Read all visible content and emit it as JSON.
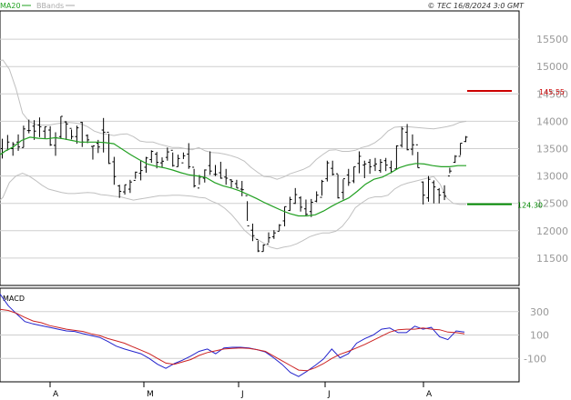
{
  "chart_data": [
    {
      "type": "line",
      "panel": "price",
      "credit": "© TEC 16/8/2024 3:0 GMT",
      "legend": [
        {
          "name": "MA20",
          "color": "#22a022"
        },
        {
          "name": "BBands",
          "color": "#aaaaaa"
        }
      ],
      "x_ticks": [
        "A",
        "M",
        "J",
        "J",
        "A"
      ],
      "ylim": [
        11000,
        16000
      ],
      "y_ticks": [
        11500,
        12000,
        12500,
        13000,
        13500,
        14000,
        14500,
        15000,
        15500
      ],
      "y_tick_labels": [
        "11500",
        "12000",
        "12500",
        "13000",
        "13500",
        "14000",
        "14500",
        "15000",
        "15500"
      ],
      "grid": true,
      "ohlc": [
        [
          13500,
          13680,
          13320,
          13430
        ],
        [
          13470,
          13750,
          13470,
          13620
        ],
        [
          13500,
          13620,
          13370,
          13580
        ],
        [
          13620,
          13760,
          13460,
          13530
        ],
        [
          13520,
          13920,
          13520,
          13860
        ],
        [
          13830,
          14030,
          13780,
          13830
        ],
        [
          13910,
          14020,
          13660,
          13820
        ],
        [
          13930,
          14070,
          13710,
          13900
        ],
        [
          13820,
          13900,
          13690,
          13900
        ],
        [
          13840,
          13910,
          13550,
          13570
        ],
        [
          13560,
          13800,
          13370,
          13700
        ],
        [
          13720,
          14090,
          13680,
          14090
        ],
        [
          13990,
          14000,
          13660,
          13950
        ],
        [
          13870,
          13850,
          13670,
          13720
        ],
        [
          13720,
          13920,
          13590,
          13880
        ],
        [
          13980,
          13990,
          13530,
          13620
        ],
        [
          13740,
          13760,
          13600,
          13660
        ],
        [
          13540,
          13550,
          13300,
          13550
        ],
        [
          13600,
          13660,
          13420,
          13530
        ],
        [
          13840,
          14060,
          13430,
          13800
        ],
        [
          13800,
          13770,
          13220,
          13230
        ],
        [
          13260,
          13350,
          12840,
          12990
        ],
        [
          12820,
          12840,
          12600,
          12720
        ],
        [
          12710,
          12840,
          12660,
          12840
        ],
        [
          12760,
          12930,
          12690,
          12890
        ],
        [
          12920,
          13080,
          12950,
          13070
        ],
        [
          13050,
          13280,
          12920,
          13100
        ],
        [
          13160,
          13350,
          13060,
          13330
        ],
        [
          13300,
          13470,
          13240,
          13450
        ],
        [
          13400,
          13440,
          13140,
          13250
        ],
        [
          13240,
          13340,
          13160,
          13270
        ],
        [
          13340,
          13520,
          13280,
          13440
        ],
        [
          13470,
          13430,
          13170,
          13190
        ],
        [
          13170,
          13390,
          13170,
          13320
        ],
        [
          13240,
          13430,
          13310,
          13370
        ],
        [
          13400,
          13600,
          13130,
          13170
        ],
        [
          13160,
          13130,
          12790,
          12820
        ],
        [
          12780,
          13020,
          12840,
          12980
        ],
        [
          12960,
          13120,
          12880,
          13110
        ],
        [
          13190,
          13450,
          13020,
          13090
        ],
        [
          13030,
          13200,
          13000,
          13030
        ],
        [
          13060,
          13260,
          12950,
          12960
        ],
        [
          12980,
          13130,
          12840,
          12960
        ],
        [
          12930,
          12940,
          12790,
          12900
        ],
        [
          12860,
          12930,
          12780,
          12780
        ],
        [
          12760,
          12910,
          12630,
          12750
        ],
        [
          12640,
          12540,
          12180,
          12090
        ],
        [
          12010,
          12130,
          11810,
          11910
        ],
        [
          11840,
          11820,
          11610,
          11630
        ],
        [
          11620,
          11750,
          11620,
          11740
        ],
        [
          11760,
          11970,
          11780,
          11870
        ],
        [
          11890,
          12010,
          11850,
          11960
        ],
        [
          11990,
          12120,
          12000,
          12100
        ],
        [
          12180,
          12440,
          12080,
          12440
        ],
        [
          12370,
          12620,
          12360,
          12570
        ],
        [
          12500,
          12780,
          12490,
          12660
        ],
        [
          12600,
          12630,
          12350,
          12430
        ],
        [
          12400,
          12570,
          12270,
          12300
        ],
        [
          12350,
          12580,
          12250,
          12520
        ],
        [
          12540,
          12720,
          12520,
          12650
        ],
        [
          12610,
          12930,
          12640,
          12900
        ],
        [
          12950,
          13280,
          12900,
          13240
        ],
        [
          13140,
          13280,
          13010,
          13030
        ],
        [
          13040,
          13030,
          12590,
          12600
        ],
        [
          12700,
          12940,
          12570,
          12950
        ],
        [
          13020,
          13130,
          12820,
          12880
        ],
        [
          12910,
          13170,
          12870,
          13170
        ],
        [
          13230,
          13450,
          13050,
          13360
        ],
        [
          13200,
          13280,
          12960,
          13220
        ],
        [
          13250,
          13310,
          13040,
          13170
        ],
        [
          13190,
          13330,
          13090,
          13220
        ],
        [
          13100,
          13310,
          13060,
          13250
        ],
        [
          13280,
          13330,
          13090,
          13200
        ],
        [
          13150,
          13280,
          13050,
          13080
        ],
        [
          13130,
          13560,
          13120,
          13550
        ],
        [
          13560,
          13900,
          13520,
          13860
        ],
        [
          13800,
          13950,
          13470,
          13480
        ],
        [
          13490,
          13760,
          13380,
          13570
        ],
        [
          13570,
          13440,
          13150,
          13150
        ],
        [
          12890,
          12900,
          12480,
          12650
        ],
        [
          12600,
          13000,
          12530,
          12940
        ],
        [
          12880,
          12920,
          12500,
          12800
        ],
        [
          12750,
          12780,
          12500,
          12650
        ],
        [
          12700,
          12830,
          12560,
          12630
        ],
        [
          13000,
          13150,
          13050,
          13090
        ],
        [
          13250,
          13380,
          13240,
          13360
        ],
        [
          13360,
          13600,
          13380,
          13600
        ],
        [
          13630,
          13730,
          13620,
          13710
        ]
      ],
      "ma20": [
        13340,
        13450,
        13530,
        13650,
        13710,
        13690,
        13680,
        13700,
        13680,
        13650,
        13620,
        13620,
        13620,
        13610,
        13590,
        13490,
        13390,
        13300,
        13220,
        13180,
        13150,
        13110,
        13060,
        13020,
        13000,
        12970,
        12880,
        12820,
        12780,
        12730,
        12660,
        12590,
        12510,
        12440,
        12370,
        12310,
        12270,
        12270,
        12290,
        12360,
        12450,
        12530,
        12600,
        12720,
        12850,
        12940,
        12980,
        13060,
        13150,
        13200,
        13230,
        13220,
        13190,
        13170,
        13170,
        13190,
        13190
      ],
      "ma20_start_bar": 30,
      "bb_upper": [
        15100,
        15120,
        14950,
        14600,
        14150,
        14000,
        13940,
        13930,
        13930,
        13950,
        13970,
        13980,
        13970,
        13950,
        13900,
        13820,
        13780,
        13760,
        13740,
        13760,
        13770,
        13720,
        13640,
        13620,
        13620,
        13580,
        13550,
        13520,
        13520,
        13500,
        13480,
        13520,
        13460,
        13430,
        13420,
        13400,
        13370,
        13330,
        13270,
        13160,
        13070,
        12990,
        12980,
        12940,
        12980,
        13040,
        13080,
        13120,
        13180,
        13300,
        13390,
        13470,
        13480,
        13450,
        13450,
        13470,
        13520,
        13550,
        13610,
        13700,
        13820,
        13890,
        13900,
        13900,
        13890,
        13880,
        13870,
        13860,
        13880,
        13900,
        13930,
        13980,
        14000
      ],
      "bb_lower": [
        12500,
        12610,
        12880,
        13000,
        13050,
        13000,
        12920,
        12830,
        12760,
        12730,
        12700,
        12680,
        12680,
        12690,
        12700,
        12690,
        12660,
        12650,
        12630,
        12620,
        12590,
        12560,
        12580,
        12600,
        12620,
        12640,
        12640,
        12650,
        12650,
        12640,
        12630,
        12610,
        12600,
        12540,
        12490,
        12410,
        12300,
        12160,
        12010,
        11910,
        11840,
        11770,
        11700,
        11670,
        11700,
        11720,
        11760,
        11820,
        11890,
        11930,
        11960,
        11960,
        11990,
        12080,
        12230,
        12420,
        12510,
        12590,
        12620,
        12620,
        12650,
        12760,
        12830,
        12870,
        12900,
        12930,
        12960,
        12990,
        12850,
        12600,
        12500,
        12480,
        12480
      ],
      "bb_start_bar": 14,
      "annotations": [
        {
          "label": "145.55",
          "value": 14555,
          "color": "#cc0000"
        },
        {
          "label": "124.30",
          "value": 12484,
          "color": "#008800"
        }
      ]
    },
    {
      "type": "line",
      "panel": "macd",
      "title": "MACD",
      "ylim": [
        -300,
        500
      ],
      "y_ticks": [
        300,
        100,
        -100
      ],
      "y_tick_labels": [
        "300",
        "100",
        "-100"
      ],
      "series": [
        {
          "color": "#2222cc",
          "values": [
            450,
            350,
            280,
            215,
            195,
            180,
            165,
            150,
            135,
            130,
            112,
            95,
            80,
            45,
            5,
            -20,
            -40,
            -60,
            -100,
            -150,
            -185,
            -145,
            -115,
            -80,
            -40,
            -20,
            -60,
            -10,
            -5,
            -5,
            -10,
            -25,
            -45,
            -95,
            -150,
            -220,
            -255,
            -210,
            -160,
            -105,
            -20,
            -95,
            -60,
            30,
            70,
            100,
            150,
            160,
            120,
            120,
            175,
            150,
            165,
            85,
            60,
            135,
            125
          ]
        },
        {
          "color": "#cc2222",
          "values": [
            320,
            310,
            285,
            250,
            220,
            205,
            180,
            165,
            150,
            140,
            130,
            110,
            95,
            70,
            50,
            30,
            0,
            -30,
            -60,
            -100,
            -140,
            -150,
            -130,
            -110,
            -75,
            -50,
            -35,
            -20,
            -15,
            -10,
            -15,
            -25,
            -40,
            -80,
            -120,
            -160,
            -200,
            -205,
            -180,
            -145,
            -100,
            -65,
            -40,
            -10,
            20,
            55,
            90,
            125,
            145,
            150,
            150,
            160,
            150,
            145,
            125,
            120,
            110
          ]
        }
      ],
      "grid": true
    }
  ]
}
